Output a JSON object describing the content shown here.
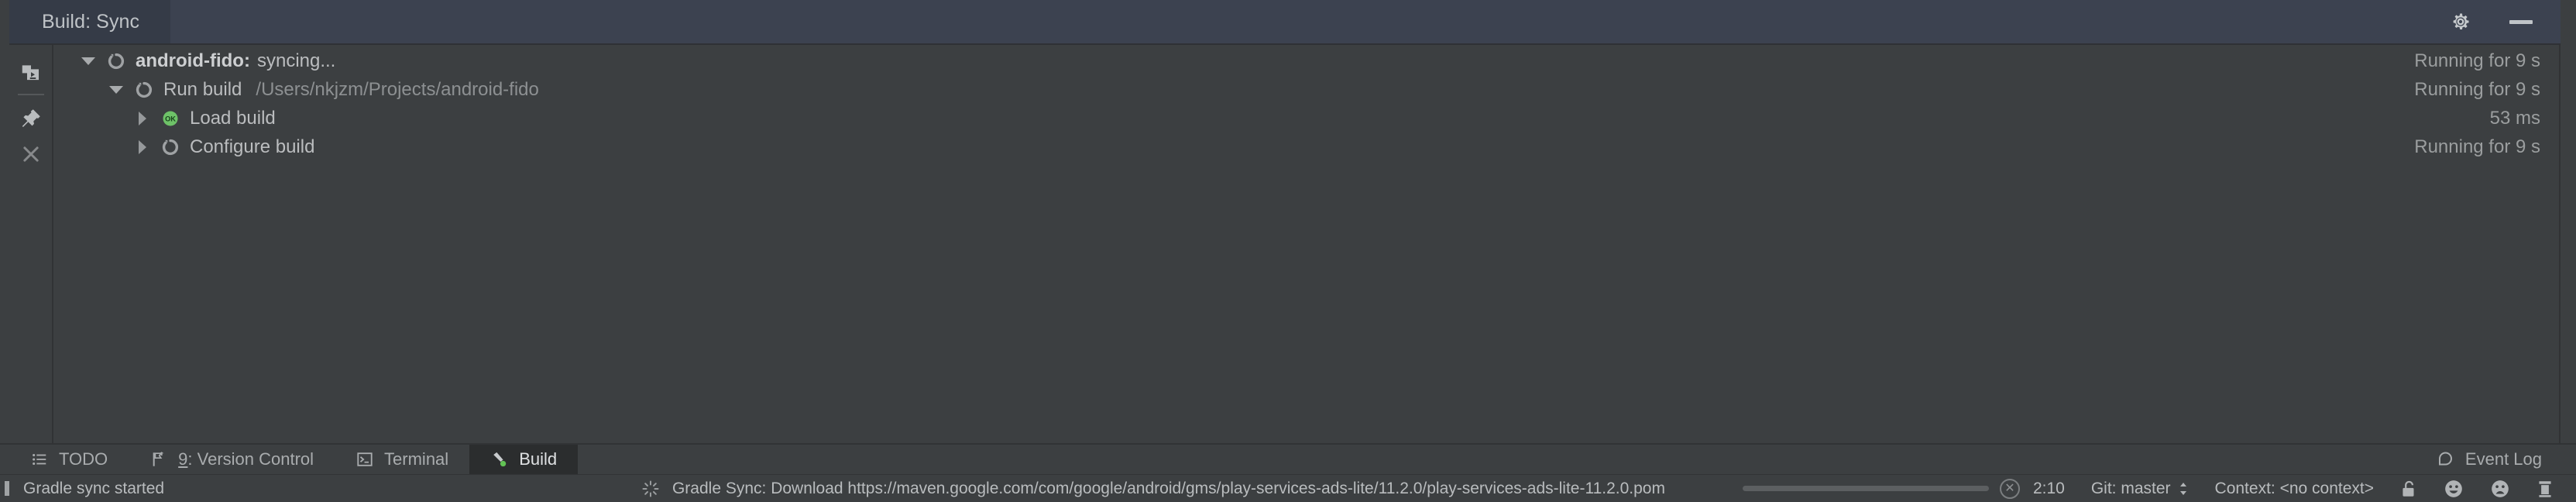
{
  "tool_window": {
    "tab_label": "Build: Sync",
    "actions": {
      "settings_icon": "gear-icon",
      "minimize_icon": "minimize-icon"
    },
    "rail": {
      "toggle_view_icon": "show-console-icon",
      "pin_icon": "pin-tab-icon",
      "close_icon": "close-icon"
    }
  },
  "build_tree": {
    "rows": [
      {
        "indent": 0,
        "twisty": "expanded",
        "icon": "spinner-icon",
        "label": "android-fido:",
        "label_bold": true,
        "suffix": "syncing...",
        "path": "",
        "time": "Running for 9 s"
      },
      {
        "indent": 1,
        "twisty": "expanded",
        "icon": "spinner-icon",
        "label": "Run build",
        "label_bold": false,
        "suffix": "",
        "path": "/Users/nkjzm/Projects/android-fido",
        "time": "Running for 9 s"
      },
      {
        "indent": 2,
        "twisty": "collapsed",
        "icon": "ok-icon",
        "label": "Load build",
        "label_bold": false,
        "suffix": "",
        "path": "",
        "time": "53 ms"
      },
      {
        "indent": 2,
        "twisty": "collapsed",
        "icon": "spinner-icon",
        "label": "Configure build",
        "label_bold": false,
        "suffix": "",
        "path": "",
        "time": "Running for 9 s"
      }
    ]
  },
  "tool_window_bar": {
    "left_buttons": [
      {
        "icon": "todo-list-icon",
        "label": "TODO",
        "mnemonic": "",
        "active": false
      },
      {
        "icon": "version-control-icon",
        "label": ": Version Control",
        "mnemonic": "9",
        "active": false
      },
      {
        "icon": "terminal-icon",
        "label": "Terminal",
        "mnemonic": "",
        "active": false
      },
      {
        "icon": "build-hammer-icon",
        "label": "Build",
        "mnemonic": "",
        "active": true
      }
    ],
    "right_buttons": [
      {
        "icon": "event-log-icon",
        "label": "Event Log",
        "mnemonic": "",
        "active": false
      }
    ]
  },
  "status_bar": {
    "message": "Gradle sync started",
    "progress_icon": "spinner-icon",
    "progress_text": "Gradle Sync: Download https://maven.google.com/com/google/android/gms/play-services-ads-lite/11.2.0/play-services-ads-lite-11.2.0.pom",
    "cancel_icon": "cancel-icon",
    "caret_position": "2:10",
    "vcs_label": "Git: master",
    "vcs_chevron_icon": "chevron-updown-icon",
    "context_label": "Context: <no context>",
    "lock_icon": "unlocked-padlock-icon",
    "happy_icon": "happy-face-icon",
    "sad_icon": "sad-face-icon",
    "memory_icon": "trash-icon"
  },
  "colors": {
    "window_bg": "#3c3f41",
    "header_bg": "#3c4250",
    "tab_active_bg": "#353b47",
    "text_primary": "#bbbdbf",
    "text_secondary": "#8d9092",
    "accent_green": "#6ec268",
    "tw_active_bg": "#2b2d2e"
  }
}
